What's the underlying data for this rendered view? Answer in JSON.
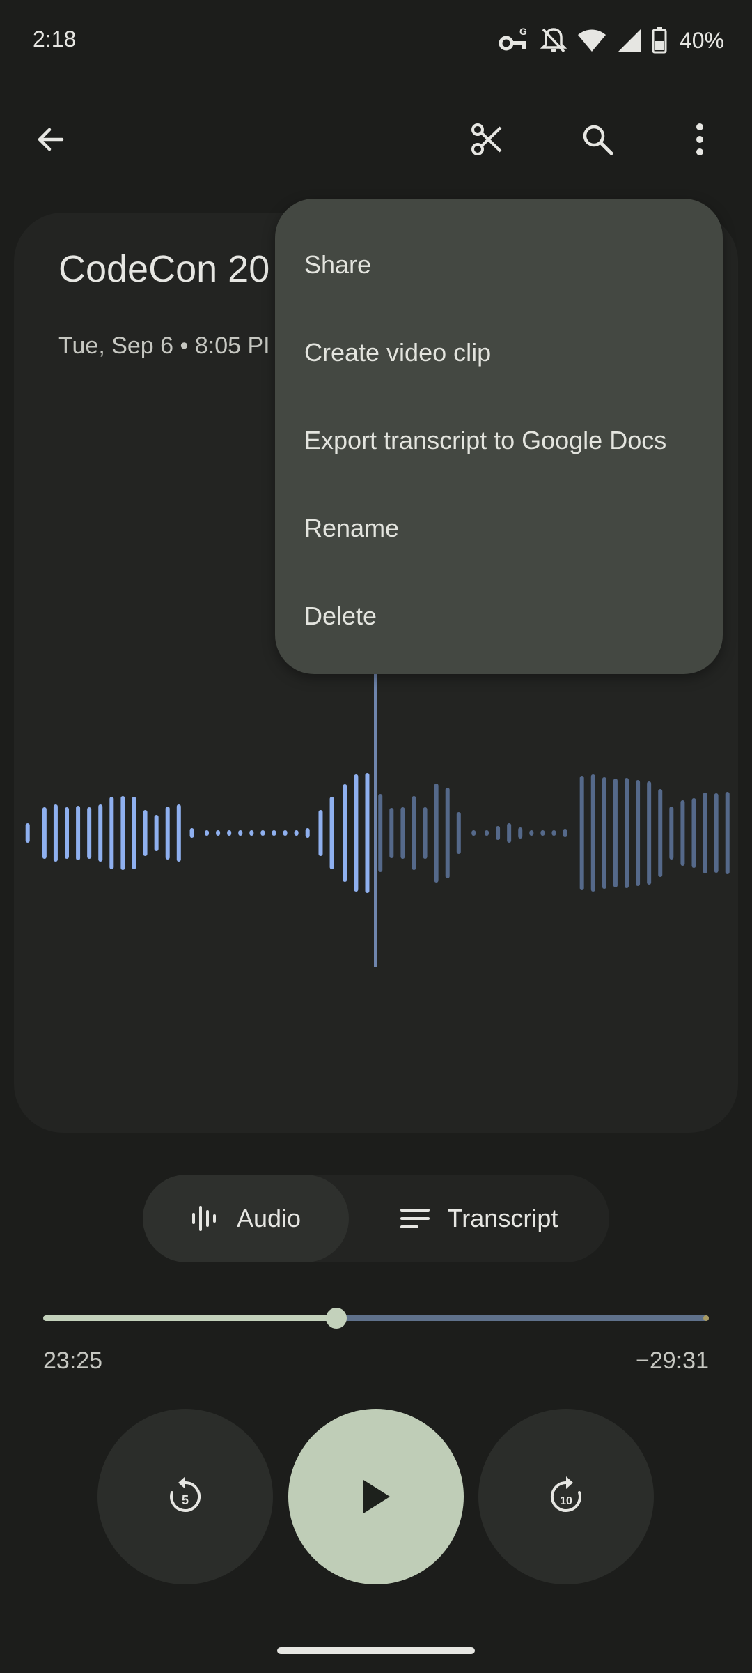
{
  "status_bar": {
    "time": "2:18",
    "battery": "40%",
    "icons": [
      "vpn-key-icon",
      "notifications-off-icon",
      "wifi-icon",
      "signal-icon",
      "battery-icon"
    ]
  },
  "app_bar": {
    "icons": [
      "back-arrow-icon",
      "scissors-icon",
      "search-icon",
      "more-vert-icon"
    ]
  },
  "recording": {
    "title": "CodeCon 20",
    "meta": "Tue, Sep 6 • 8:05 PI"
  },
  "menu": {
    "items": [
      "Share",
      "Create video clip",
      "Export transcript to Google Docs",
      "Rename",
      "Delete"
    ]
  },
  "toggle": {
    "audio_label": "Audio",
    "transcript_label": "Transcript",
    "selected": "Audio"
  },
  "player": {
    "elapsed": "23:25",
    "remaining": "−29:31",
    "progress_fraction": 0.44,
    "rewind_seconds": "5",
    "forward_seconds": "10"
  },
  "colors": {
    "played_wave": "#8fb0ef",
    "unplayed_wave": "#55698a",
    "accent": "#bfcdb7",
    "menu_bg": "#444842"
  }
}
